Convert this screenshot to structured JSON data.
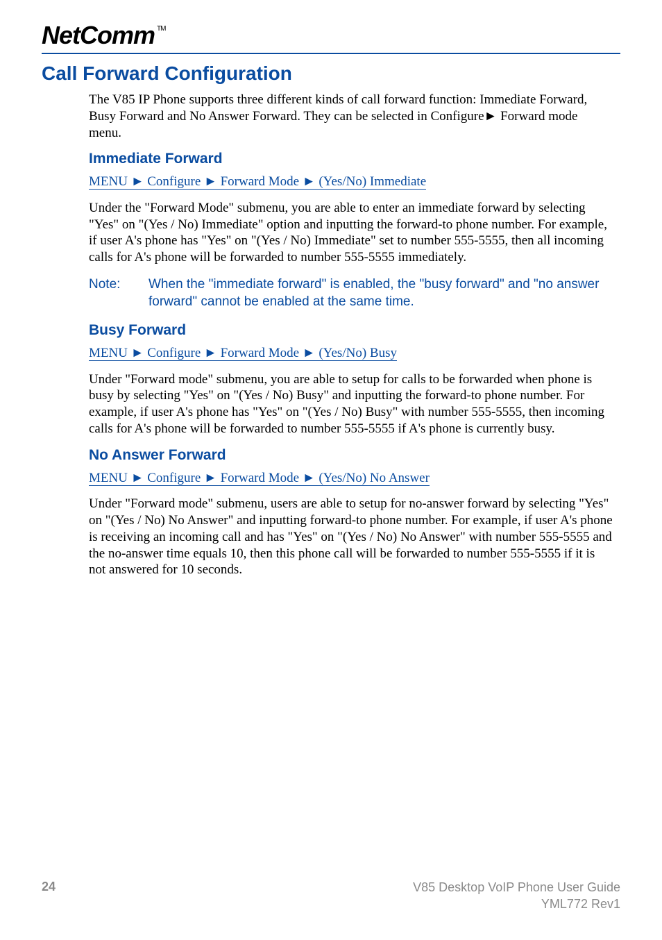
{
  "brand": {
    "logo_text": "NetComm",
    "tm": "TM"
  },
  "title": "Call Forward Configuration",
  "intro": "The V85 IP Phone supports three different kinds of call forward function: Immediate Forward, Busy Forward and No Answer Forward. They can be selected in Configure► Forward mode menu.",
  "sections": {
    "immediate": {
      "heading": "Immediate Forward",
      "menupath": "MENU ► Configure ► Forward Mode ► (Yes/No) Immediate",
      "body": "Under the \"Forward Mode\" submenu, you are able to enter an immediate forward by selecting \"Yes\" on \"(Yes / No) Immediate\" option and inputting the forward-to phone number. For example, if user A's phone has \"Yes\" on \"(Yes / No) Immediate\" set to number 555-5555, then all incoming calls for A's phone will be forwarded to number 555-5555 immediately.",
      "note_label": "Note:",
      "note_text": "When the \"immediate forward\" is enabled, the \"busy forward\" and \"no answer forward\" cannot be enabled at the same time."
    },
    "busy": {
      "heading": "Busy Forward",
      "menupath": "MENU ► Configure ► Forward Mode ► (Yes/No) Busy",
      "body": "Under \"Forward mode\" submenu, you are able to setup for calls to be forwarded when phone is busy by selecting \"Yes\" on \"(Yes / No) Busy\" and inputting the forward-to phone number. For example, if user A's phone has \"Yes\" on \"(Yes / No) Busy\" with number 555-5555, then incoming calls for A's phone will be forwarded to number 555-5555 if A's phone is currently busy."
    },
    "noanswer": {
      "heading": "No Answer Forward",
      "menupath": "MENU ► Configure ► Forward Mode ► (Yes/No) No Answer",
      "body": "Under \"Forward mode\" submenu, users are able to setup for no-answer forward by selecting \"Yes\" on \"(Yes / No) No Answer\" and inputting forward-to phone number. For example, if user A's phone is receiving an incoming call and has \"Yes\" on \"(Yes / No) No Answer\" with number 555-5555 and the no-answer time equals 10, then this phone call will be forwarded to number 555-5555 if it is not answered for 10 seconds."
    }
  },
  "footer": {
    "page_number": "24",
    "doc_title": "V85 Desktop VoIP Phone User Guide",
    "doc_rev": "YML772 Rev1"
  }
}
